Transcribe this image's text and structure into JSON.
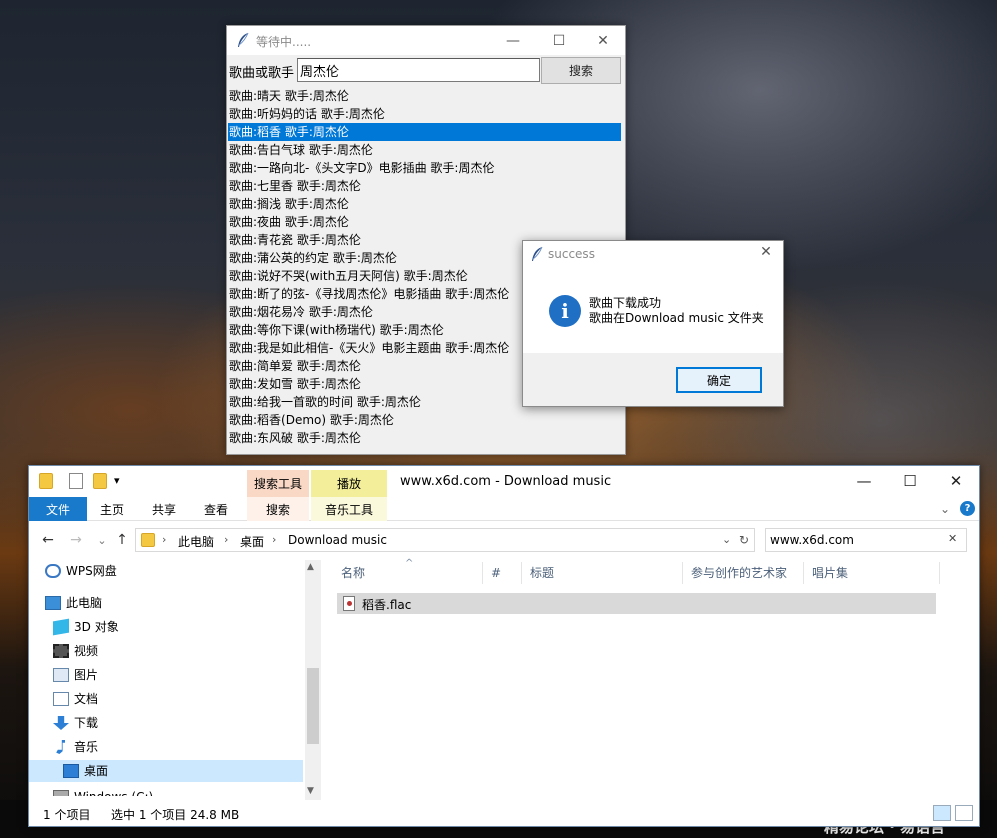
{
  "watermark": "精易论坛 · 易语言",
  "tk_window": {
    "title": "等待中.....",
    "controls": {
      "minimize": "—",
      "maximize": "☐",
      "close": "✕"
    },
    "search_label": "歌曲或歌手",
    "search_value": "周杰伦",
    "search_button": "搜索",
    "selected_index": 2,
    "results": [
      "歌曲:晴天  歌手:周杰伦",
      "歌曲:听妈妈的话  歌手:周杰伦",
      "歌曲:稻香  歌手:周杰伦",
      "歌曲:告白气球  歌手:周杰伦",
      "歌曲:一路向北-《头文字D》电影插曲  歌手:周杰伦",
      "歌曲:七里香  歌手:周杰伦",
      "歌曲:搁浅  歌手:周杰伦",
      "歌曲:夜曲  歌手:周杰伦",
      "歌曲:青花瓷  歌手:周杰伦",
      "歌曲:蒲公英的约定  歌手:周杰伦",
      "歌曲:说好不哭(with五月天阿信)  歌手:周杰伦",
      "歌曲:断了的弦-《寻找周杰伦》电影插曲  歌手:周杰伦",
      "歌曲:烟花易冷  歌手:周杰伦",
      "歌曲:等你下课(with杨瑞代)  歌手:周杰伦",
      "歌曲:我是如此相信-《天火》电影主题曲  歌手:周杰伦",
      "歌曲:简单爱  歌手:周杰伦",
      "歌曲:发如雪  歌手:周杰伦",
      "歌曲:给我一首歌的时间  歌手:周杰伦",
      "歌曲:稻香(Demo)  歌手:周杰伦",
      "歌曲:东风破  歌手:周杰伦"
    ]
  },
  "dialog": {
    "title": "success",
    "close": "✕",
    "icon_glyph": "i",
    "message_line1": "歌曲下载成功",
    "message_line2": "歌曲在Download music 文件夹",
    "ok_button": "确定"
  },
  "explorer": {
    "title": "www.x6d.com - Download music",
    "qa_dropdown": "▾",
    "controls": {
      "minimize": "—",
      "maximize": "☐",
      "close": "✕"
    },
    "context_tabs": {
      "search_tools": "搜索工具",
      "play": "播放"
    },
    "ribbon_tabs": {
      "file": "文件",
      "home": "主页",
      "share": "共享",
      "view": "查看",
      "search": "搜索",
      "music_tools": "音乐工具"
    },
    "ribbon_right": {
      "expand": "⌄",
      "help": "?"
    },
    "nav_buttons": {
      "back": "←",
      "forward": "→",
      "recent": "⌄",
      "up": "↑"
    },
    "breadcrumbs": [
      "此电脑",
      "桌面",
      "Download music"
    ],
    "crumb_sep": "›",
    "address_dropdown": "⌄",
    "refresh": "↻",
    "search_value": "www.x6d.com",
    "search_clear": "✕",
    "nav_items": [
      {
        "label": "WPS网盘",
        "icon": "cloud-icon"
      },
      {
        "label": "此电脑",
        "icon": "computer-icon"
      },
      {
        "label": "3D 对象",
        "icon": "cube-icon"
      },
      {
        "label": "视频",
        "icon": "video-icon"
      },
      {
        "label": "图片",
        "icon": "picture-icon"
      },
      {
        "label": "文档",
        "icon": "document-icon"
      },
      {
        "label": "下载",
        "icon": "download-icon"
      },
      {
        "label": "音乐",
        "icon": "music-icon"
      },
      {
        "label": "桌面",
        "icon": "desktop-icon"
      },
      {
        "label": "Windows (C:)",
        "icon": "drive-icon"
      }
    ],
    "scroll_up": "▲",
    "scroll_down": "▼",
    "columns": [
      "名称",
      "#",
      "标题",
      "参与创作的艺术家",
      "唱片集"
    ],
    "sort_indicator": "^",
    "files": [
      {
        "name": "稻香.flac",
        "icon": "audio-file-icon"
      }
    ],
    "status": {
      "items": "1 个项目",
      "selected": "选中 1 个项目  24.8 MB"
    }
  }
}
